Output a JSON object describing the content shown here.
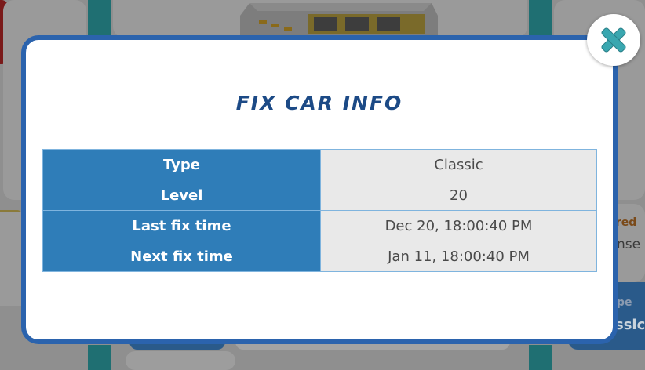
{
  "modal": {
    "title": "FIX CAR INFO",
    "rows": [
      {
        "label": "Type",
        "value": "Classic"
      },
      {
        "label": "Level",
        "value": "20"
      },
      {
        "label": "Last fix time",
        "value": "Dec 20, 18:00:40 PM"
      },
      {
        "label": "Next fix time",
        "value": "Jan 11, 18:00:40 PM"
      }
    ],
    "close_icon": "close-icon"
  },
  "background": {
    "right_label_1": "ired",
    "right_label_2": "nse",
    "right_label_3": "pe",
    "right_label_4": "ssic"
  },
  "colors": {
    "modal_border": "#2b63ad",
    "title": "#1c4a86",
    "label_cell": "#2f7db8",
    "value_cell": "#e9e9e9",
    "close_icon": "#3aa7b0"
  }
}
